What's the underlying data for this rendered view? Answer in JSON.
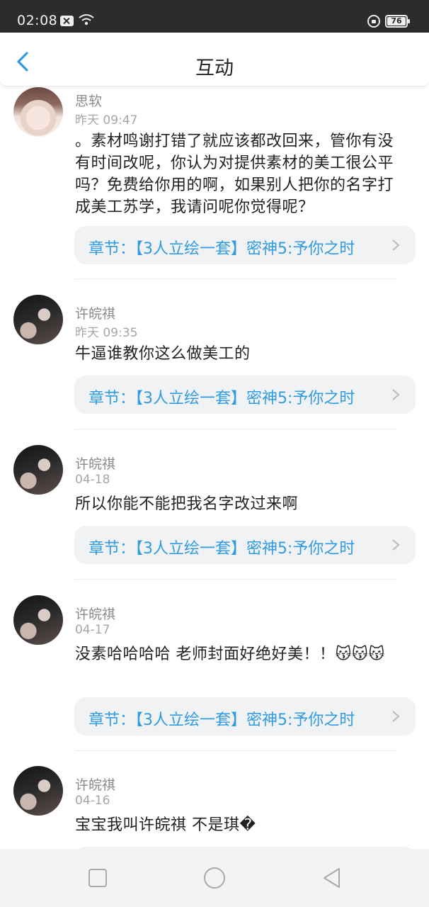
{
  "status_bar": {
    "time": "02:08",
    "battery": "76",
    "icons": [
      "notification-icon",
      "wifi-icon",
      "lock-rotation-icon",
      "battery-icon"
    ]
  },
  "header": {
    "title": "互动",
    "back_icon": "chevron-left-icon",
    "accent_color": "#2f9be0"
  },
  "comments": [
    {
      "user": "思软",
      "time": "昨天 09:47",
      "text": "。素材鸣谢打错了就应该都改回来，管你有没有时间改呢，你认为对提供素材的美工很公平吗？免费给你用的啊，如果别人把你的名字打成美工苏学，我请问呢你觉得呢？",
      "chapter": "章节：【3人立绘一套】密神5:予你之时"
    },
    {
      "user": "许皖祺",
      "time": "昨天 09:35",
      "text": "牛逼谁教你这么做美工的",
      "chapter": "章节：【3人立绘一套】密神5:予你之时"
    },
    {
      "user": "许皖祺",
      "time": "04-18",
      "text": "所以你能不能把我名字改过来啊",
      "chapter": "章节：【3人立绘一套】密神5:予你之时"
    },
    {
      "user": "许皖祺",
      "time": "04-17",
      "text": "没素哈哈哈哈 老师封面好绝好美！！😽😽😽",
      "chapter": "章节：【3人立绘一套】密神5:予你之时"
    },
    {
      "user": "许皖祺",
      "time": "04-16",
      "text": "宝宝我叫许皖祺 不是琪�",
      "chapter": ""
    }
  ],
  "nav_bar": {
    "icons": [
      "square-recents-icon",
      "circle-home-icon",
      "triangle-back-icon"
    ]
  }
}
